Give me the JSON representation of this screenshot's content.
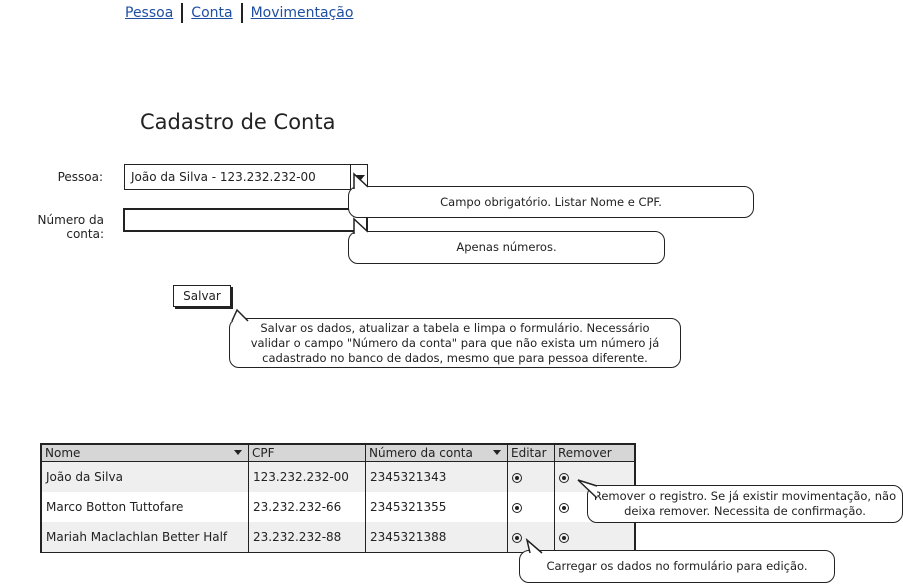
{
  "nav": {
    "items": [
      "Pessoa",
      "Conta",
      "Movimentação"
    ]
  },
  "page_title": "Cadastro de Conta",
  "form": {
    "pessoa_label": "Pessoa:",
    "pessoa_value": "João da Silva - 123.232.232-00",
    "numero_label": "Número da conta:",
    "numero_value": "",
    "save_label": "Salvar"
  },
  "notes": {
    "pessoa": "Campo obrigatório. Listar Nome e CPF.",
    "numero": "Apenas números.",
    "salvar": "Salvar os dados, atualizar a tabela e limpa o formulário. Necessário validar o campo \"Número da conta\" para que não exista um número já cadastrado no banco de dados, mesmo que para pessoa diferente.",
    "remover": "Remover o registro. Se já existir movimentação, não deixa remover. Necessita de confirmação.",
    "editar": "Carregar os dados no formulário para edição."
  },
  "table": {
    "headers": [
      "Nome",
      "CPF",
      "Número da conta",
      "Editar",
      "Remover"
    ],
    "rows": [
      [
        "João da Silva",
        "123.232.232-00",
        "2345321343"
      ],
      [
        "Marco Botton Tuttofare",
        "23.232.232-66",
        "2345321355"
      ],
      [
        "Mariah Maclachlan Better Half",
        "23.232.232-88",
        "2345321388"
      ]
    ]
  }
}
